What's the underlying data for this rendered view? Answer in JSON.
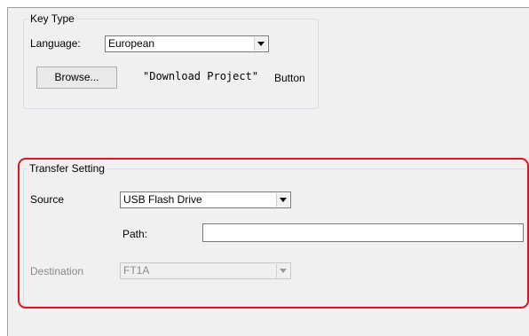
{
  "key_type": {
    "title": "Key Type",
    "language_label": "Language:",
    "language_value": "European",
    "browse_button": "Browse...",
    "download_text": "\"Download Project\"",
    "download_suffix": "Button"
  },
  "transfer_setting": {
    "title": "Transfer Setting",
    "source_label": "Source",
    "source_value": "USB Flash Drive",
    "path_label": "Path:",
    "path_value": "",
    "destination_label": "Destination",
    "destination_value": "FT1A",
    "destination_enabled": false
  },
  "colors": {
    "highlight": "#e0141e",
    "window_bg": "#f0f0f0"
  },
  "icons": [
    "dropdown-arrow-icon"
  ]
}
